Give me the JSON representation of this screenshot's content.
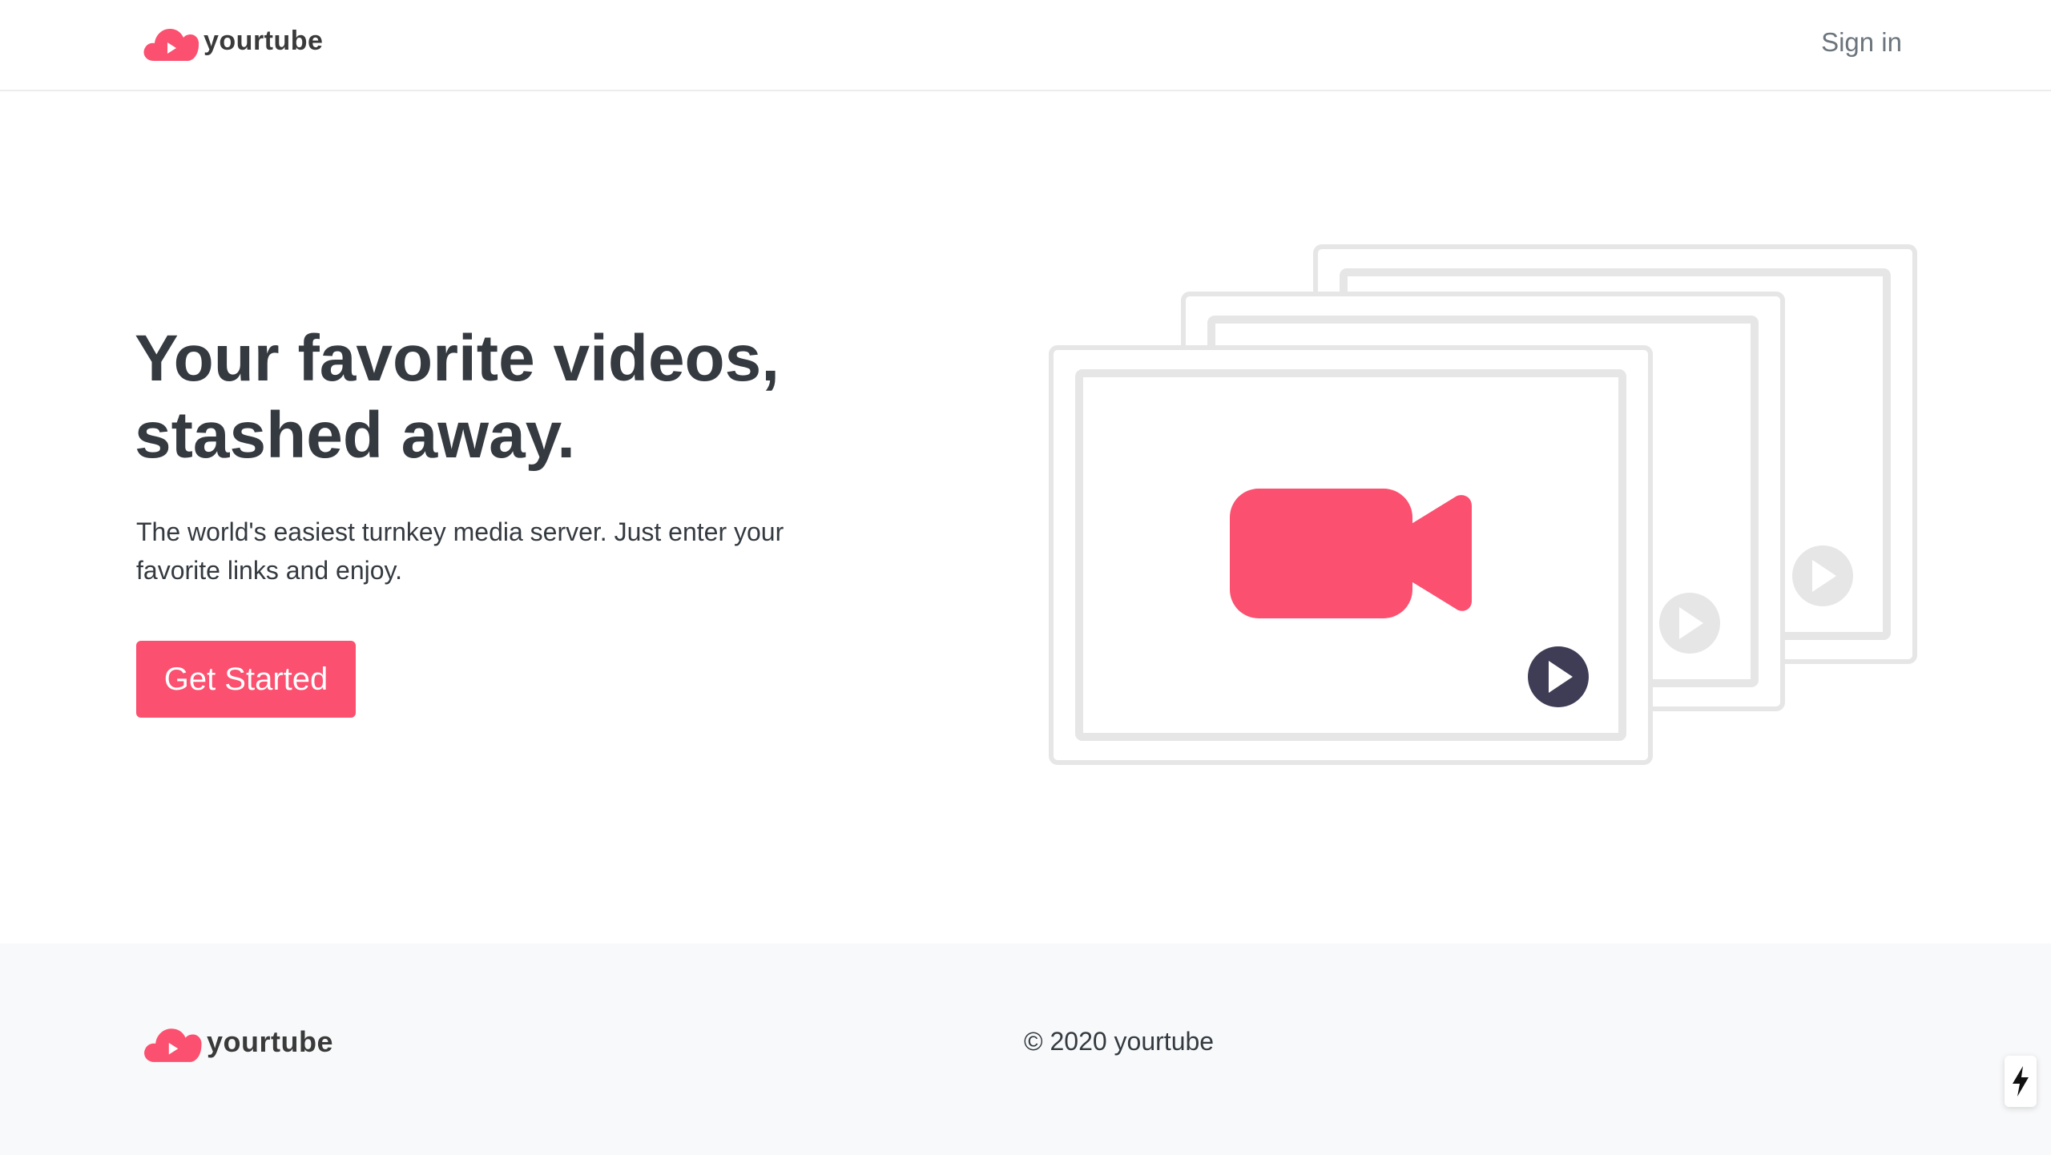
{
  "brand": {
    "name": "yourtube",
    "accent_color": "#fb506f"
  },
  "header": {
    "signin_label": "Sign in"
  },
  "hero": {
    "title_line1": "Your favorite videos,",
    "title_line2": "stashed away.",
    "subtitle_line1": "The world's easiest turnkey media server. Just enter your",
    "subtitle_line2": "favorite links and enjoy.",
    "cta_label": "Get Started",
    "illustration_icons": [
      "video-camera-icon",
      "play-icon"
    ]
  },
  "footer": {
    "copyright": "© 2020 yourtube"
  },
  "floating": {
    "icon": "lightning-bolt-icon"
  }
}
